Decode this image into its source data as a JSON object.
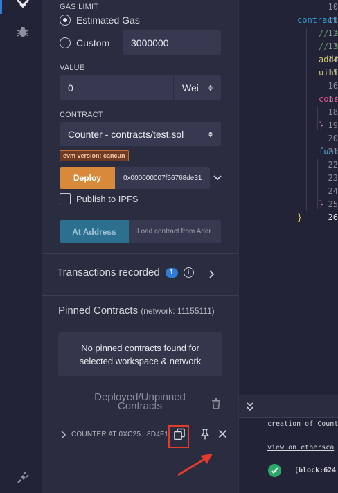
{
  "rail": {
    "icons": [
      "deploy-run-icon",
      "debugger-icon",
      "plugin-manager-icon"
    ]
  },
  "run_panel": {
    "gas_limit": {
      "label": "GAS LIMIT",
      "options": [
        {
          "label": "Estimated Gas",
          "selected": true
        },
        {
          "label": "Custom",
          "selected": false
        }
      ],
      "custom_value": "3000000"
    },
    "value": {
      "label": "VALUE",
      "amount": "0",
      "unit": "Wei"
    },
    "contract": {
      "label": "CONTRACT",
      "selected": "Counter - contracts/test.sol",
      "evm_badge": "evm version: cancun"
    },
    "deploy": {
      "button_label": "Deploy",
      "constructor_input": "0x000000007f56768de31"
    },
    "publish_ipfs": {
      "label": "Publish to IPFS",
      "checked": false
    },
    "at_address": {
      "button_label": "At Address",
      "placeholder": "Load contract from Addr"
    },
    "transactions": {
      "label": "Transactions recorded",
      "count": "1",
      "info_glyph": "i"
    },
    "pinned": {
      "title": "Pinned Contracts",
      "network": "(network: 11155111)",
      "empty_line1": "No pinned contracts found for",
      "empty_line2": "selected workspace & network"
    },
    "deployed": {
      "title": "Deployed/Unpinned Contracts",
      "title_line1": "Deployed/Unpinned",
      "title_line2": "Contracts",
      "instance_name": "COUNTER AT 0XC25...8D4F1"
    }
  },
  "editor": {
    "lines": [
      {
        "n": "10",
        "text": ""
      },
      {
        "n": "11",
        "text": "contract"
      },
      {
        "n": "12",
        "text": "// s"
      },
      {
        "n": "13",
        "text": "// s"
      },
      {
        "n": "14",
        "text": "addr"
      },
      {
        "n": "15",
        "text": "uint"
      },
      {
        "n": "16",
        "text": ""
      },
      {
        "n": "17",
        "text": "cons"
      },
      {
        "n": "18",
        "text": ""
      },
      {
        "n": "19",
        "text": "}"
      },
      {
        "n": "20",
        "text": ""
      },
      {
        "n": "21",
        "text": "func"
      },
      {
        "n": "22",
        "text": ""
      },
      {
        "n": "23",
        "text": ""
      },
      {
        "n": "24",
        "text": ""
      },
      {
        "n": "25",
        "text": "}"
      },
      {
        "n": "26",
        "text": "}"
      }
    ],
    "current_line": "26"
  },
  "terminal": {
    "line1": "creation of Counte",
    "link": "view on ethersca",
    "block": "[block:624"
  },
  "colors": {
    "accent": "#2f7bd6",
    "deploy": "#d88a3a",
    "at_address": "#2c6f8f",
    "highlight": "#e23b2a",
    "success": "#2aa86a"
  }
}
